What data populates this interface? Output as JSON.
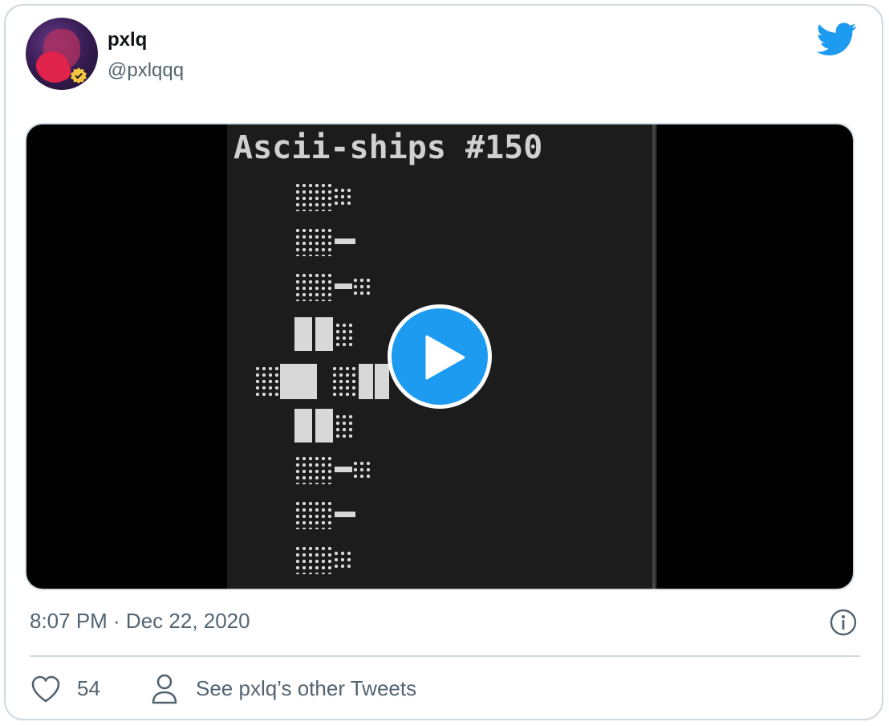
{
  "author": {
    "name": "pxlq",
    "handle": "@pxlqqq",
    "verified": true
  },
  "icons": {
    "brand": "twitter-bird-icon",
    "play": "play-icon",
    "info": "info-icon",
    "like": "heart-icon",
    "profile": "person-icon",
    "verified": "verified-badge-icon"
  },
  "media": {
    "type": "video",
    "frame_text": "Ascii-ships #150"
  },
  "tweet": {
    "timestamp": "8:07 PM · Dec 22, 2020",
    "like_count": "54",
    "see_other_tweets": "See pxlq’s other Tweets"
  },
  "colors": {
    "accent": "#1d9bf0",
    "text_primary": "#0f1419",
    "text_secondary": "#536471",
    "border": "#cfd9de",
    "verified_badge": "#f4c542"
  }
}
